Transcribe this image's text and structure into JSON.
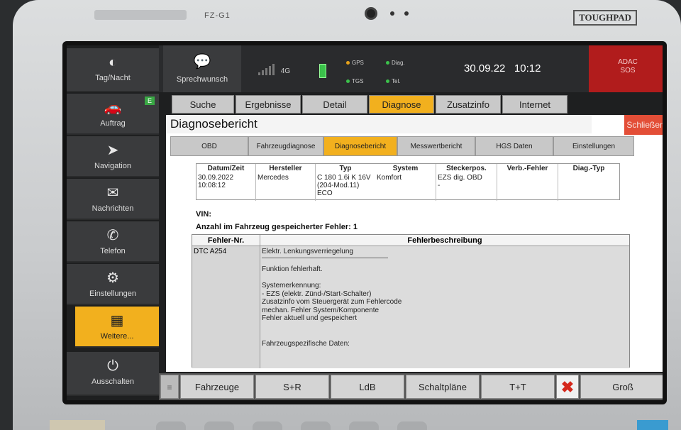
{
  "device": {
    "model": "FZ-G1",
    "brand": "TOUGHPAD"
  },
  "sidebar": {
    "items": [
      {
        "label": "Tag/Nacht",
        "icon": "half-circle-icon"
      },
      {
        "label": "Auftrag",
        "icon": "car-icon",
        "badge": "E"
      },
      {
        "label": "Navigation",
        "icon": "compass-arrow-icon"
      },
      {
        "label": "Nachrichten",
        "icon": "envelope-icon"
      },
      {
        "label": "Telefon",
        "icon": "phone-icon"
      },
      {
        "label": "Einstellungen",
        "icon": "gears-icon"
      },
      {
        "label": "Weitere...",
        "icon": "grid-icon"
      },
      {
        "label": "Ausschalten",
        "icon": "power-icon"
      }
    ]
  },
  "status": {
    "sprechwunsch": "Sprechwunsch",
    "network": "4G",
    "gps": "GPS",
    "tgs": "TGS",
    "diag": "Diag.",
    "tel": "Tel.",
    "date": "30.09.22",
    "time": "10:12",
    "sos_line1": "ADAC",
    "sos_line2": "SOS",
    "colors": {
      "gps": "#e6a21b",
      "tgs": "#3bc24b",
      "diag": "#3bc24b",
      "tel": "#3bc24b"
    }
  },
  "main_tabs": [
    "Suche",
    "Ergebnisse",
    "Detail",
    "Diagnose",
    "Zusatzinfo",
    "Internet"
  ],
  "main_tab_active": "Diagnose",
  "panel": {
    "title": "Diagnosebericht",
    "close": "Schließen",
    "sub_tabs": [
      "OBD",
      "Fahrzeugdiagnose",
      "Diagnosebericht",
      "Messwertbericht",
      "HGS Daten",
      "Einstellungen"
    ],
    "sub_tab_active": "Diagnosebericht",
    "info": {
      "headers": [
        "Datum/Zeit",
        "Hersteller",
        "Typ",
        "System",
        "Steckerpos.",
        "Verb.-Fehler",
        "Diag.-Typ"
      ],
      "values": [
        "30.09.2022\n10:08:12",
        "Mercedes",
        "C 180 1.6i K 16V\n(204-Mod.11)\nECO",
        "Komfort",
        "EZS dig. OBD\n-",
        "",
        ""
      ]
    },
    "vin_label": "VIN:",
    "fault_count": "Anzahl im Fahrzeug gespeicherter Fehler: 1",
    "fault_table": {
      "headers": [
        "Fehler-Nr.",
        "Fehlerbeschreibung"
      ],
      "code": "DTC A254",
      "desc_title": "Elektr. Lenkungsverriegelung",
      "desc_function": "Funktion fehlerhaft.",
      "desc_lines": [
        "Systemerkennung:",
        "- EZS (elektr. Zünd-/Start-Schalter)",
        "Zusatzinfo vom Steuergerät zum Fehlercode",
        "mechan. Fehler System/Komponente",
        "Fehler aktuell und gespeichert"
      ],
      "desc_footer": "Fahrzeugspezifische Daten:"
    }
  },
  "bottom": {
    "handle": "≡",
    "buttons": [
      "Fahrzeuge",
      "S+R",
      "LdB",
      "Schaltpläne",
      "T+T"
    ],
    "close_icon": "✖",
    "gross": "Groß"
  },
  "accent": "#f2b01e"
}
